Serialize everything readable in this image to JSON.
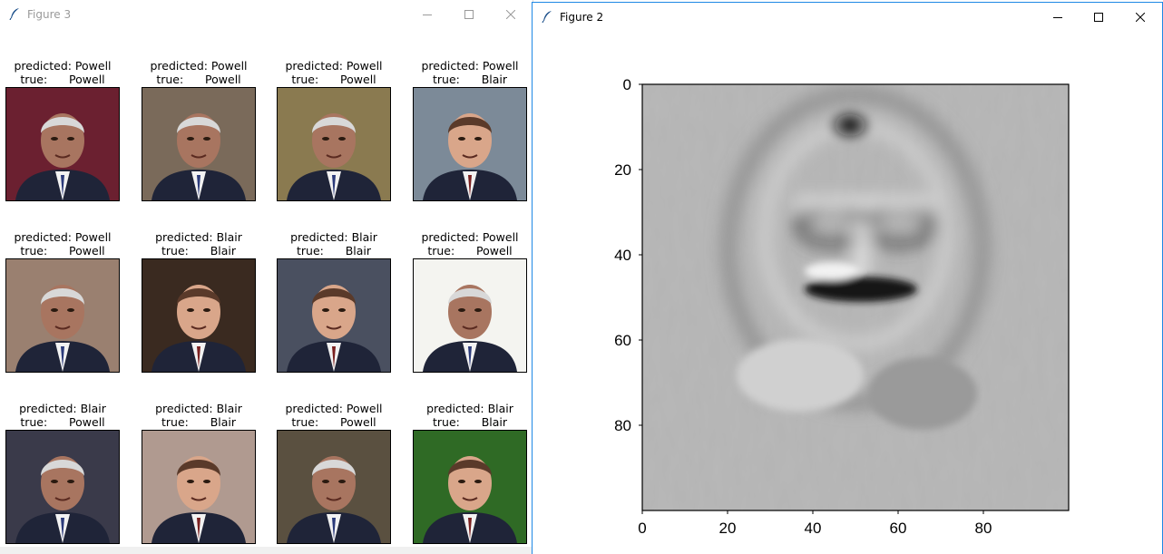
{
  "windows": {
    "figure3": {
      "title": "Figure 3",
      "controls": {
        "minimize": "minimize-icon",
        "maximize": "maximize-icon",
        "close": "close-icon"
      },
      "thumbnails": [
        {
          "predicted": "predicted: Powell",
          "true": "true:      Powell",
          "subject": "Powell",
          "bg": "#6b2030"
        },
        {
          "predicted": "predicted: Powell",
          "true": "true:      Powell",
          "subject": "Powell",
          "bg": "#7a6a5a"
        },
        {
          "predicted": "predicted: Powell",
          "true": "true:      Powell",
          "subject": "Powell",
          "bg": "#8a7a50"
        },
        {
          "predicted": "predicted: Powell",
          "true": "true:      Blair",
          "subject": "Blair",
          "bg": "#7c8a98"
        },
        {
          "predicted": "predicted: Powell",
          "true": "true:      Powell",
          "subject": "Powell",
          "bg": "#9a8070"
        },
        {
          "predicted": "predicted: Blair",
          "true": "true:      Blair",
          "subject": "Blair",
          "bg": "#3a2a20"
        },
        {
          "predicted": "predicted: Blair",
          "true": "true:      Blair",
          "subject": "Blair",
          "bg": "#4a5060"
        },
        {
          "predicted": "predicted: Powell",
          "true": "true:      Powell",
          "subject": "Powell",
          "bg": "#f4f4f0"
        },
        {
          "predicted": "predicted: Blair",
          "true": "true:      Powell",
          "subject": "Powell",
          "bg": "#3a3a4a"
        },
        {
          "predicted": "predicted: Blair",
          "true": "true:      Blair",
          "subject": "Blair",
          "bg": "#b09a90"
        },
        {
          "predicted": "predicted: Powell",
          "true": "true:      Powell",
          "subject": "Powell",
          "bg": "#5a5040"
        },
        {
          "predicted": "predicted: Blair",
          "true": "true:      Blair",
          "subject": "Blair",
          "bg": "#2f6a25"
        }
      ]
    },
    "figure2": {
      "title": "Figure 2",
      "controls": {
        "minimize": "minimize-icon",
        "maximize": "maximize-icon",
        "close": "close-icon"
      },
      "image_plot": {
        "xticks": [
          "0",
          "20",
          "40",
          "60",
          "80"
        ],
        "yticks": [
          "0",
          "20",
          "40",
          "60",
          "80"
        ],
        "xlim": [
          0,
          100
        ],
        "ylim": [
          0,
          100
        ],
        "colormap": "gray"
      }
    }
  }
}
